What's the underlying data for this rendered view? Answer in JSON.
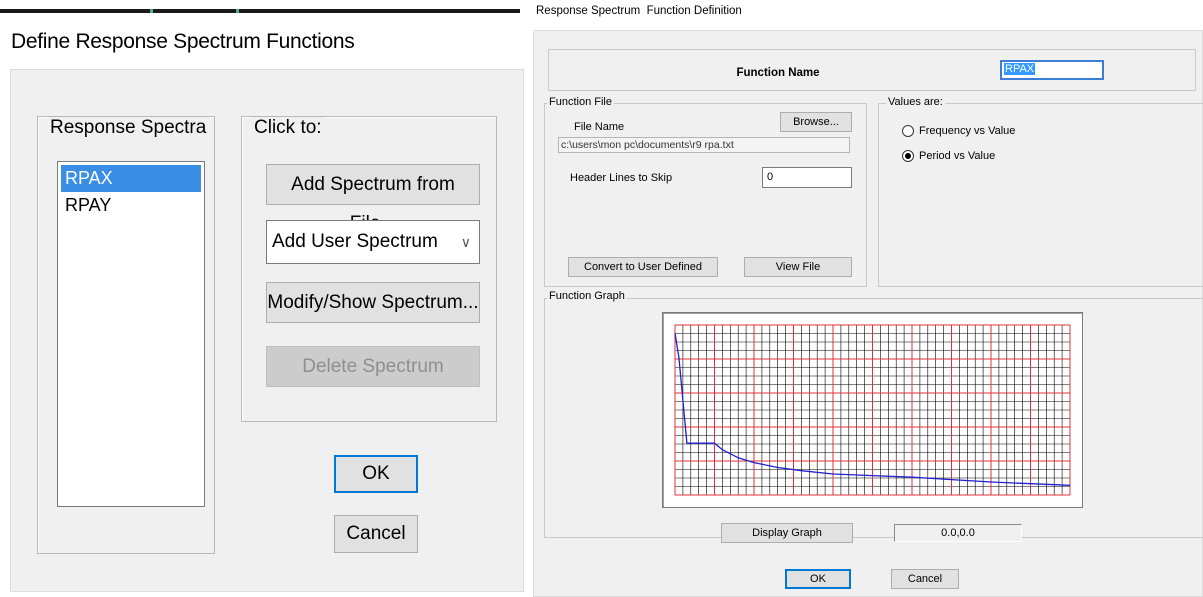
{
  "left_dialog": {
    "title": "Define Response Spectrum Functions",
    "spectra_group_label": "Response Spectra",
    "spectra": [
      "RPAX",
      "RPAY"
    ],
    "selected_spectrum": "RPAX",
    "click_group_label": "Click to:",
    "add_from_file_label": "Add Spectrum from File...",
    "add_user_dropdown_value": "Add User Spectrum",
    "modify_label": "Modify/Show Spectrum...",
    "delete_label": "Delete Spectrum",
    "ok_label": "OK",
    "cancel_label": "Cancel"
  },
  "right_dialog": {
    "title": "Response Spectrum  Function Definition",
    "function_name_label": "Function Name",
    "function_name_value": "RPAX",
    "function_file_label": "Function File",
    "file_name_label": "File Name",
    "browse_label": "Browse...",
    "file_path": "c:\\users\\mon pc\\documents\\r9 rpa.txt",
    "header_lines_label": "Header Lines to Skip",
    "header_lines_value": "0",
    "convert_label": "Convert to User Defined",
    "view_file_label": "View File",
    "values_are_label": "Values are:",
    "radio_options": [
      "Frequency vs Value",
      "Period vs Value"
    ],
    "selected_option": "Period vs Value",
    "function_graph_label": "Function Graph",
    "display_graph_label": "Display Graph",
    "coordinate_readout": "0.0,0.0",
    "ok_label": "OK",
    "cancel_label": "Cancel"
  },
  "chart_data": {
    "type": "line",
    "grid": true,
    "series": [
      {
        "x": [
          0.0,
          0.05,
          0.15,
          0.5,
          0.6,
          0.8,
          1.0,
          1.3,
          1.6,
          2.0,
          2.5,
          3.0,
          3.5,
          4.0,
          4.5,
          5.0
        ],
        "values": [
          1.0,
          0.85,
          0.32,
          0.32,
          0.28,
          0.23,
          0.2,
          0.17,
          0.15,
          0.13,
          0.12,
          0.11,
          0.095,
          0.08,
          0.07,
          0.06
        ]
      }
    ],
    "xlim": [
      0,
      5
    ],
    "ylim": [
      0,
      1.05
    ],
    "colors": {
      "line": "#2020d0",
      "major_grid": "#e0303a",
      "minor_grid": "#000000"
    }
  }
}
